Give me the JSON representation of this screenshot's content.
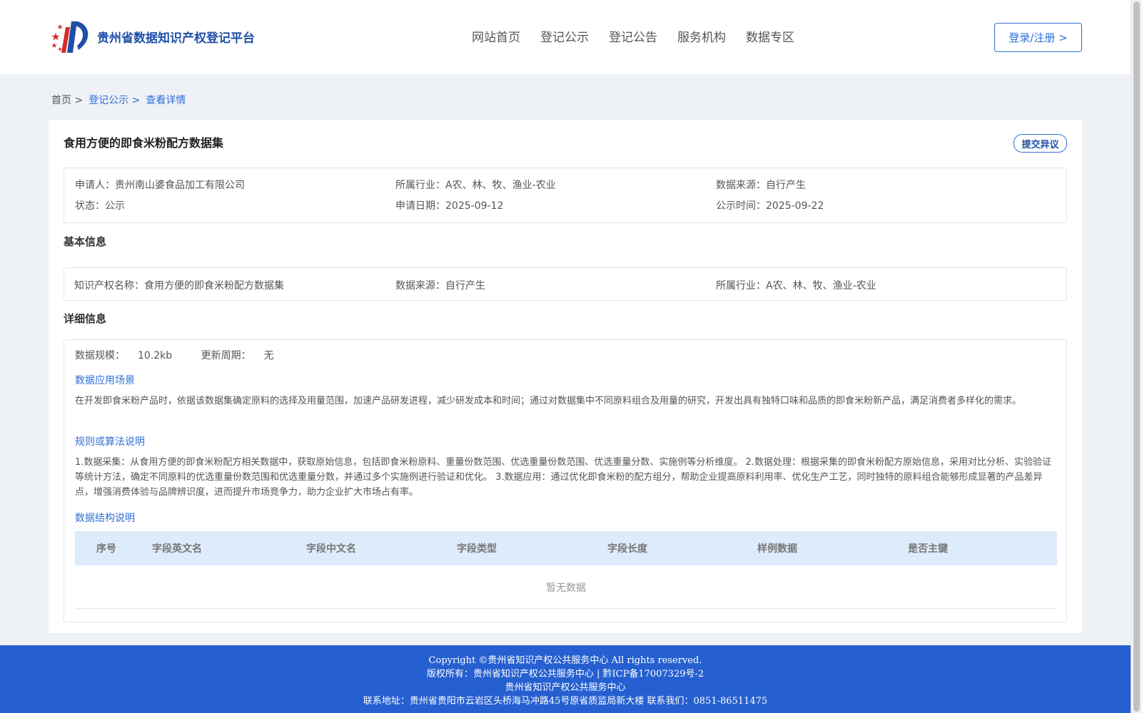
{
  "header": {
    "site_name": "贵州省数据知识产权登记平台",
    "nav": [
      "网站首页",
      "登记公示",
      "登记公告",
      "服务机构",
      "数据专区"
    ],
    "login_label": "登录/注册 >"
  },
  "breadcrumb": {
    "home": "首页 >",
    "listing": "登记公示 >",
    "current": "查看详情"
  },
  "record": {
    "title": "食用方便的即食米粉配方数据集",
    "objection_label": "提交异议",
    "summary": {
      "applicant_label": "申请人：",
      "applicant": "贵州南山婆食品加工有限公司",
      "industry_label": "所属行业：",
      "industry": "A农、林、牧、渔业-农业",
      "source_label": "数据来源：",
      "source": "自行产生",
      "status_label": "状态：",
      "status": "公示",
      "apply_date_label": "申请日期：",
      "apply_date": "2025-09-12",
      "publicity_label": "公示时间：",
      "publicity_date": "2025-09-22"
    },
    "basic": {
      "section_title": "基本信息",
      "ip_name_label": "知识产权名称：",
      "ip_name": "食用方便的即食米粉配方数据集",
      "source_label": "数据来源：",
      "source": "自行产生",
      "industry_label": "所属行业：",
      "industry": "A农、林、牧、渔业-农业"
    },
    "detail": {
      "section_title": "详细信息",
      "scale_label": "数据规模：",
      "scale": "10.2kb",
      "update_label": "更新周期：",
      "update": "无",
      "scenario_title": "数据应用场景",
      "scenario_text": "在开发即食米粉产品时，依据该数据集确定原料的选择及用量范围，加速产品研发进程，减少研发成本和时间；通过对数据集中不同原料组合及用量的研究，开发出具有独特口味和品质的即食米粉新产品，满足消费者多样化的需求。",
      "algorithm_title": "规则或算法说明",
      "algorithm_text": "1.数据采集：从食用方便的即食米粉配方相关数据中，获取原始信息，包括即食米粉原料、重量份数范围、优选重量份数范围、优选重量分数、实施例等分析维度。 2.数据处理：根据采集的即食米粉配方原始信息，采用对比分析、实验验证等统计方法，确定不同原料的优选重量份数范围和优选重量分数，并通过多个实施例进行验证和优化。 3.数据应用：通过优化即食米粉的配方组分，帮助企业提高原料利用率、优化生产工艺，同时独特的原料组合能够形成显著的产品差异点，增强消费体验与品牌辨识度，进而提升市场竞争力，助力企业扩大市场占有率。",
      "structure_title": "数据结构说明",
      "columns": [
        "序号",
        "字段英文名",
        "字段中文名",
        "字段类型",
        "字段长度",
        "样例数据",
        "是否主键"
      ],
      "empty_text": "暂无数据"
    }
  },
  "footer": {
    "copyright": "Copyright ©贵州省知识产权公共服务中心 All rights reserved.",
    "owner": "版权所有：贵州省知识产权公共服务中心 | 黔ICP备17007329号-2",
    "org": "贵州省知识产权公共服务中心",
    "contact": "联系地址：贵州省贵阳市云岩区头桥海马冲路45号原省质监局新大楼 联系我们：0851-86511475"
  }
}
